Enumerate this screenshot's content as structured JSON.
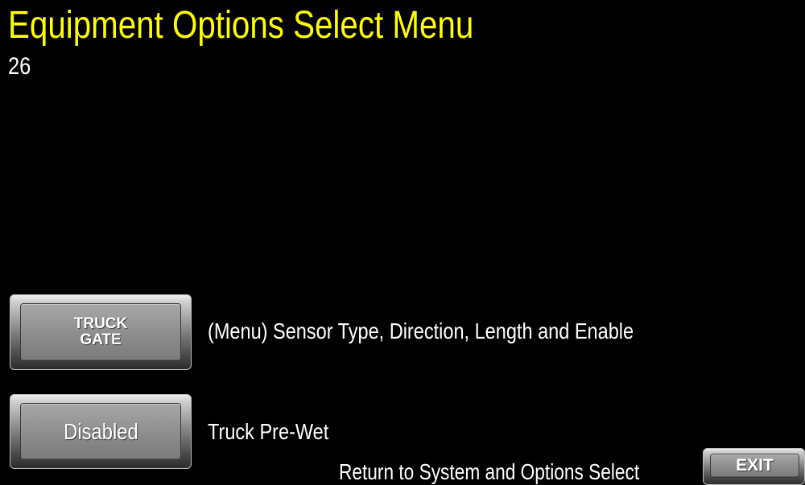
{
  "header": {
    "title": "Equipment Options Select Menu",
    "screen_number": "26"
  },
  "options": {
    "truck_gate": {
      "button_line1": "TRUCK",
      "button_line2": "GATE",
      "description": "(Menu) Sensor Type, Direction, Length and Enable"
    },
    "prewet": {
      "button_label": "Disabled",
      "description": "Truck Pre-Wet"
    }
  },
  "footer": {
    "return_text": "Return to System and Options Select",
    "exit_label": "EXIT"
  },
  "colors": {
    "background": "#000000",
    "title": "#ffff00",
    "text": "#ffffff",
    "button_face": "#8f8f8f"
  }
}
